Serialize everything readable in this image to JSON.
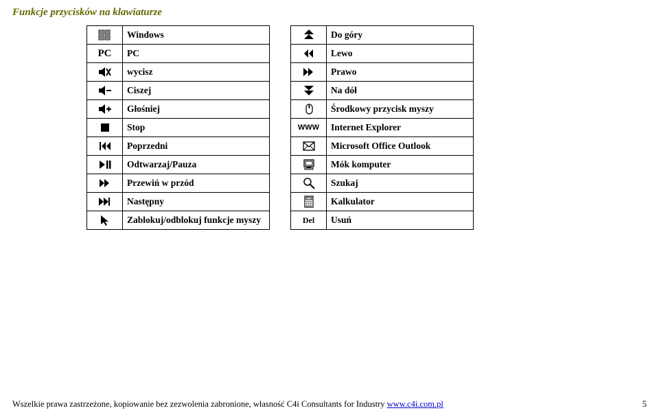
{
  "title": "Funkcje przycisków na klawiaturze",
  "left": [
    {
      "icon": "windows",
      "label": "Windows"
    },
    {
      "icon": "pc",
      "label": "PC"
    },
    {
      "icon": "mute",
      "label": "wycisz"
    },
    {
      "icon": "vol-down",
      "label": "Ciszej"
    },
    {
      "icon": "vol-up",
      "label": "Głośniej"
    },
    {
      "icon": "stop",
      "label": "Stop"
    },
    {
      "icon": "prev",
      "label": "Poprzedni"
    },
    {
      "icon": "play-pause",
      "label": "Odtwarzaj/Pauza"
    },
    {
      "icon": "ffwd",
      "label": "Przewiń w przód"
    },
    {
      "icon": "next",
      "label": "Następny"
    },
    {
      "icon": "cursor",
      "label": "Zablokuj/odblokuj funkcje myszy"
    }
  ],
  "right": [
    {
      "icon": "up",
      "label": "Do góry"
    },
    {
      "icon": "rew",
      "label": "Lewo"
    },
    {
      "icon": "ffwd2",
      "label": "Prawo"
    },
    {
      "icon": "down",
      "label": "Na dół"
    },
    {
      "icon": "mouse",
      "label": "Środkowy przycisk myszy"
    },
    {
      "icon": "www",
      "label": "Internet Explorer"
    },
    {
      "icon": "mail",
      "label": "Microsoft Office Outlook"
    },
    {
      "icon": "computer",
      "label": "Mók komputer"
    },
    {
      "icon": "search",
      "label": "Szukaj"
    },
    {
      "icon": "calc",
      "label": "Kalkulator"
    },
    {
      "icon": "del",
      "label": "Usuń"
    }
  ],
  "icon_text": {
    "pc": "PC",
    "www": "WWW",
    "del": "Del"
  },
  "footer_text": "Wszelkie prawa zastrzeżone, kopiowanie bez zezwolenia zabronione, własność C4i Consultants for Industry ",
  "footer_link": "www.c4i.com.pl",
  "page_number": "5"
}
